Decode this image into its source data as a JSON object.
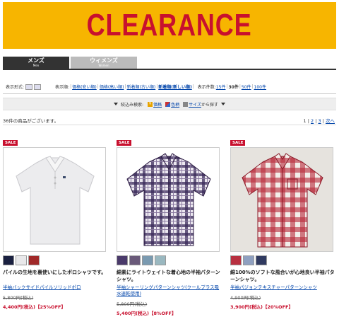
{
  "banner": {
    "title": "CLEARANCE"
  },
  "tabs": [
    {
      "label": "メンズ",
      "sub": "Men"
    },
    {
      "label": "ウィメンズ",
      "sub": "Women"
    }
  ],
  "sortbar": {
    "display_format_label": "表示形式:",
    "display_order_label": "表示順:",
    "order_options": [
      "価格(安い順)",
      "価格(高い順)",
      "新着順(古い順)",
      "新着順(新しい順)"
    ],
    "per_page_label": "表示件数:",
    "per_page_options": [
      "15件",
      "30件",
      "50件",
      "100件"
    ]
  },
  "filterbar": {
    "label": "絞込み検索:",
    "price": "価格",
    "color": "色柄",
    "size": "サイズ",
    "suffix": "から探す"
  },
  "count": {
    "text": "36件の商品がございます。"
  },
  "pager": {
    "p1": "1",
    "p2": "2",
    "p3": "3",
    "next": "次へ",
    "sep": "|"
  },
  "products": [
    {
      "badge": "SALE",
      "desc": "パイルの生地を裏使いにしたポロシャツです。",
      "name": "半袖バックサイドパイルソリッドポロ",
      "orig": "5,800円(税込)",
      "price": "4,400円(税込)【25%OFF】",
      "swatches": [
        "#1a2040",
        "#e8e8ea",
        "#a02828"
      ]
    },
    {
      "badge": "SALE",
      "desc": "綿素にライトウェイトな着心地の半袖パターンシャツ。",
      "name": "半袖シャーリングパターンシャツ(クールプラス吸水速乾使用)",
      "orig": "5,800円(税込)",
      "price": "5,400円(税込)【8%OFF】",
      "swatches": [
        "#4a3a6a",
        "#6a5a7a",
        "#7a9ab0",
        "#9ab8c0"
      ]
    },
    {
      "badge": "SALE",
      "desc": "綿100%のソフトな風合いが心地良い半袖パターンシャツ。",
      "name": "半袖パジョンテキスチャーパターンシャツ",
      "orig": "4,900円(税込)",
      "price": "3,900円(税込)【20%OFF】",
      "swatches": [
        "#b83040",
        "#8fa0c0",
        "#303a60"
      ]
    }
  ],
  "colors": {
    "accent": "#c8102e",
    "banner_bg": "#f7b500",
    "link": "#0044aa"
  }
}
